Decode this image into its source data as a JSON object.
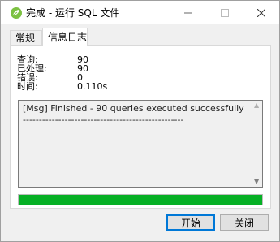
{
  "window": {
    "title": "完成 - 运行 SQL 文件",
    "app_icon": "green-leaf-icon",
    "controls": {
      "minimize": "minimize-icon",
      "maximize": "maximize-icon",
      "close": "close-icon"
    }
  },
  "tabs": [
    {
      "label": "常规",
      "selected": false
    },
    {
      "label": "信息日志",
      "selected": true
    }
  ],
  "stats": [
    {
      "label": "查询:",
      "value": "90"
    },
    {
      "label": "已处理:",
      "value": "90"
    },
    {
      "label": "错误:",
      "value": "0"
    },
    {
      "label": "时间:",
      "value": "0.110s"
    }
  ],
  "log": {
    "lines": [
      "[Msg] Finished - 90 queries executed successfully",
      "--------------------------------------------------"
    ]
  },
  "progress": {
    "percent": 100,
    "color": "#06b025"
  },
  "buttons": {
    "start": "开始",
    "close": "关闭"
  }
}
